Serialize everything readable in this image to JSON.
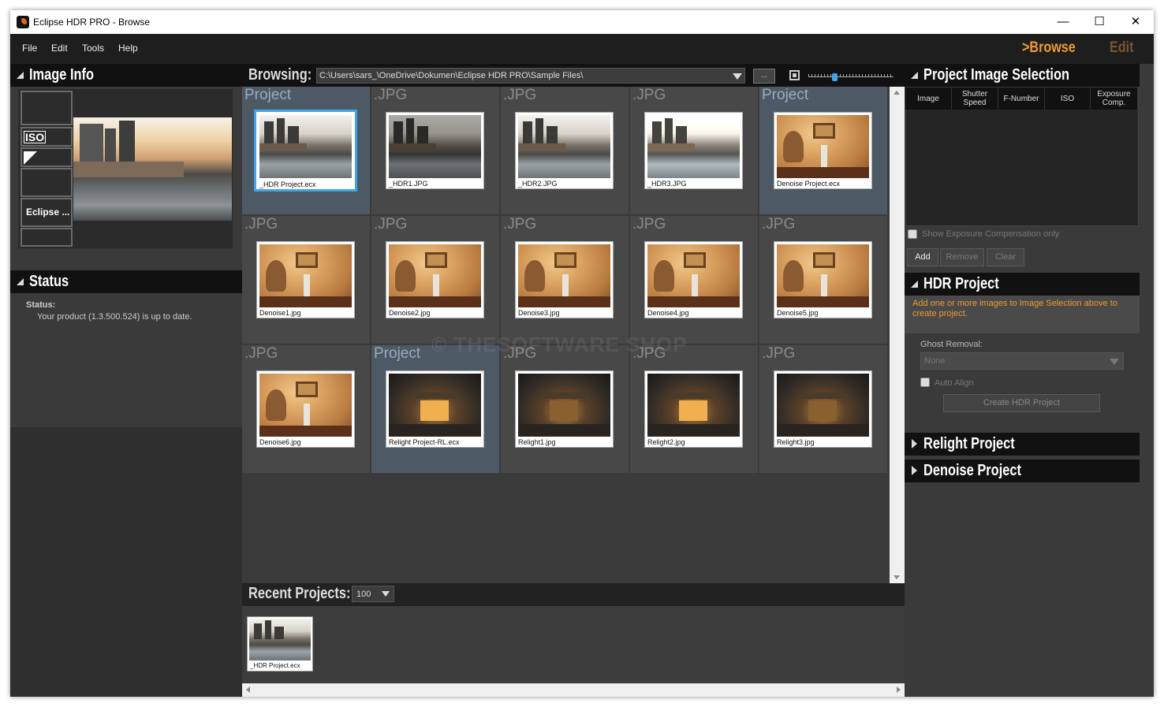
{
  "window": {
    "title": "Eclipse HDR PRO - Browse"
  },
  "titlebar_buttons": {
    "minimize": "—",
    "maximize": "☐",
    "close": "✕"
  },
  "menu": [
    "File",
    "Edit",
    "Tools",
    "Help"
  ],
  "modes": {
    "browse": ">Browse",
    "edit": "Edit"
  },
  "image_info": {
    "title": "Image Info",
    "side_buttons": [
      "",
      "ISO",
      "",
      "",
      "Eclipse ...",
      ""
    ]
  },
  "status": {
    "title": "Status",
    "label": "Status:",
    "message": "Your product (1.3.500.524) is up to date."
  },
  "browse": {
    "label": "Browsing:",
    "path": "C:\\Users\\sars_\\OneDrive\\Dokumen\\Eclipse HDR PRO\\Sample Files\\",
    "more_button": "...",
    "zoom_level": 0.3
  },
  "grid": [
    {
      "type": "Project",
      "name": "_HDR Project.ecx",
      "img": "city",
      "selected": true
    },
    {
      "type": ".JPG",
      "name": "_HDR1.JPG",
      "img": "city-dark"
    },
    {
      "type": ".JPG",
      "name": "_HDR2.JPG",
      "img": "city"
    },
    {
      "type": ".JPG",
      "name": "_HDR3.JPG",
      "img": "city-light"
    },
    {
      "type": "Project",
      "name": "Denoise Project.ecx",
      "img": "warm"
    },
    {
      "type": ".JPG",
      "name": "Denoise1.jpg",
      "img": "warm"
    },
    {
      "type": ".JPG",
      "name": "Denoise2.jpg",
      "img": "warm"
    },
    {
      "type": ".JPG",
      "name": "Denoise3.jpg",
      "img": "warm"
    },
    {
      "type": ".JPG",
      "name": "Denoise4.jpg",
      "img": "warm"
    },
    {
      "type": ".JPG",
      "name": "Denoise5.jpg",
      "img": "warm"
    },
    {
      "type": ".JPG",
      "name": "Denoise6.jpg",
      "img": "warm"
    },
    {
      "type": "Project",
      "name": "Relight Project-RL.ecx",
      "img": "dark-lit"
    },
    {
      "type": ".JPG",
      "name": "Relight1.jpg",
      "img": "dark"
    },
    {
      "type": ".JPG",
      "name": "Relight2.jpg",
      "img": "dark-lit"
    },
    {
      "type": ".JPG",
      "name": "Relight3.jpg",
      "img": "dark"
    }
  ],
  "watermark": "© THESOFTWARE SHOP",
  "recent": {
    "label": "Recent Projects:",
    "count": "100",
    "items": [
      {
        "name": "_HDR Project.ecx"
      }
    ]
  },
  "project_selection": {
    "title": "Project Image Selection",
    "columns": [
      "Image",
      "Shutter\nSpeed",
      "F-Number",
      "ISO",
      "Exposure\nComp."
    ],
    "show_ec_only": "Show Exposure Compensation only",
    "add": "Add",
    "remove": "Remove",
    "clear": "Clear"
  },
  "hdr_project": {
    "title": "HDR Project",
    "hint": "Add one or more images to Image Selection above to create project.",
    "ghost_label": "Ghost Removal:",
    "ghost_value": "None",
    "auto_align": "Auto Align",
    "create": "Create HDR Project"
  },
  "relight_project": {
    "title": "Relight Project"
  },
  "denoise_project": {
    "title": "Denoise Project"
  },
  "colors": {
    "accent": "#f29a2e",
    "hint": "#f29a2e",
    "selection": "#3da5f0"
  }
}
